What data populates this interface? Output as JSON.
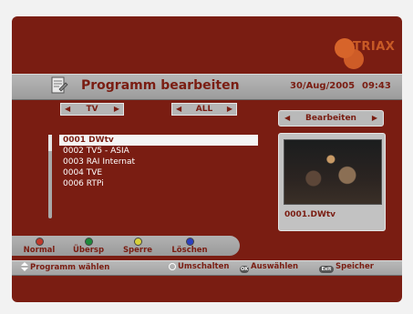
{
  "logo": {
    "text": "TRIAX"
  },
  "header": {
    "title": "Programm bearbeiten",
    "date": "30/Aug/2005",
    "time": "09:43"
  },
  "filters": [
    {
      "label": "TV"
    },
    {
      "label": "ALL"
    }
  ],
  "mode": {
    "label": "Bearbeiten"
  },
  "channels": [
    {
      "text": "0001 DWtv",
      "selected": true
    },
    {
      "text": "0002 TV5 - ASIA",
      "selected": false
    },
    {
      "text": "0003 RAI Internat",
      "selected": false
    },
    {
      "text": "0004 TVE",
      "selected": false
    },
    {
      "text": "0006 RTPi",
      "selected": false
    }
  ],
  "preview": {
    "channel_label": "0001.DWtv"
  },
  "color_keys": [
    {
      "label": "Normal",
      "color": "#c0392b"
    },
    {
      "label": "Übersp",
      "color": "#1e8a3a"
    },
    {
      "label": "Sperre",
      "color": "#d8d23a"
    },
    {
      "label": "Löschen",
      "color": "#2b3fbf"
    }
  ],
  "hints": {
    "select": "Programm wählen",
    "switch": "Umschalten",
    "choose": "Auswählen",
    "save": "Speicher",
    "ok_glyph": "OK",
    "exit_glyph": "Exit"
  }
}
